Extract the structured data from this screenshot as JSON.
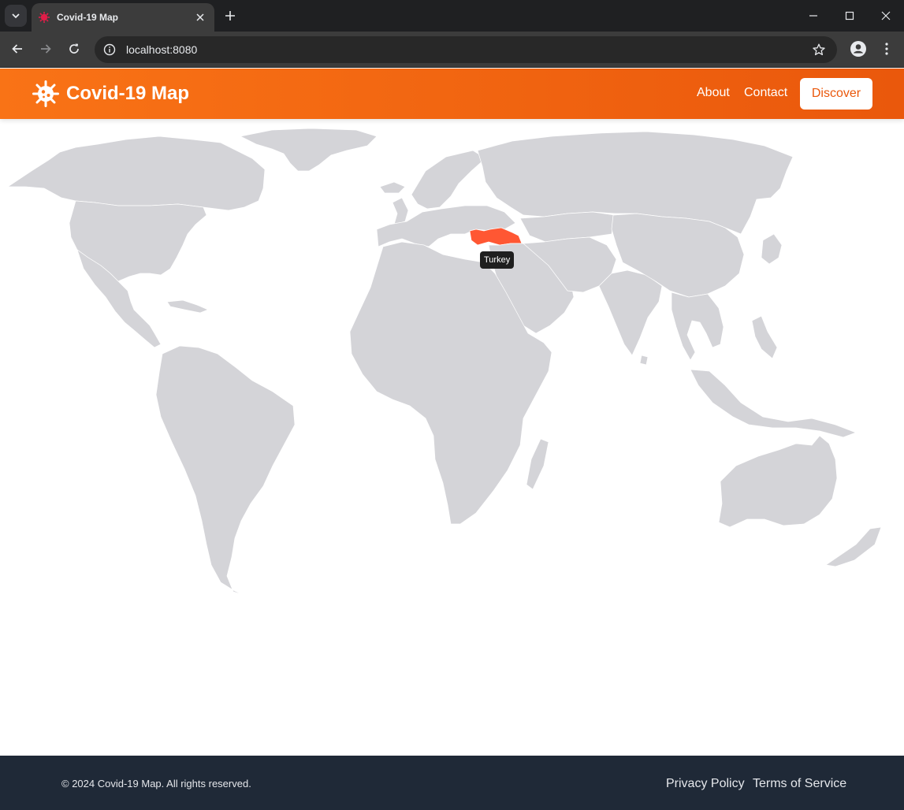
{
  "browser": {
    "tab_title": "Covid-19 Map",
    "url": "localhost:8080"
  },
  "header": {
    "brand": "Covid-19 Map",
    "nav": [
      "About",
      "Contact"
    ],
    "cta": "Discover"
  },
  "map": {
    "highlighted_country": "Turkey",
    "tooltip": "Turkey",
    "colors": {
      "land": "#d4d4d8",
      "highlight": "#ff5733",
      "header_accent": "#f97316"
    }
  },
  "footer": {
    "copyright": "© 2024 Covid-19 Map. All rights reserved.",
    "links": [
      "Privacy Policy",
      "Terms of Service"
    ]
  }
}
